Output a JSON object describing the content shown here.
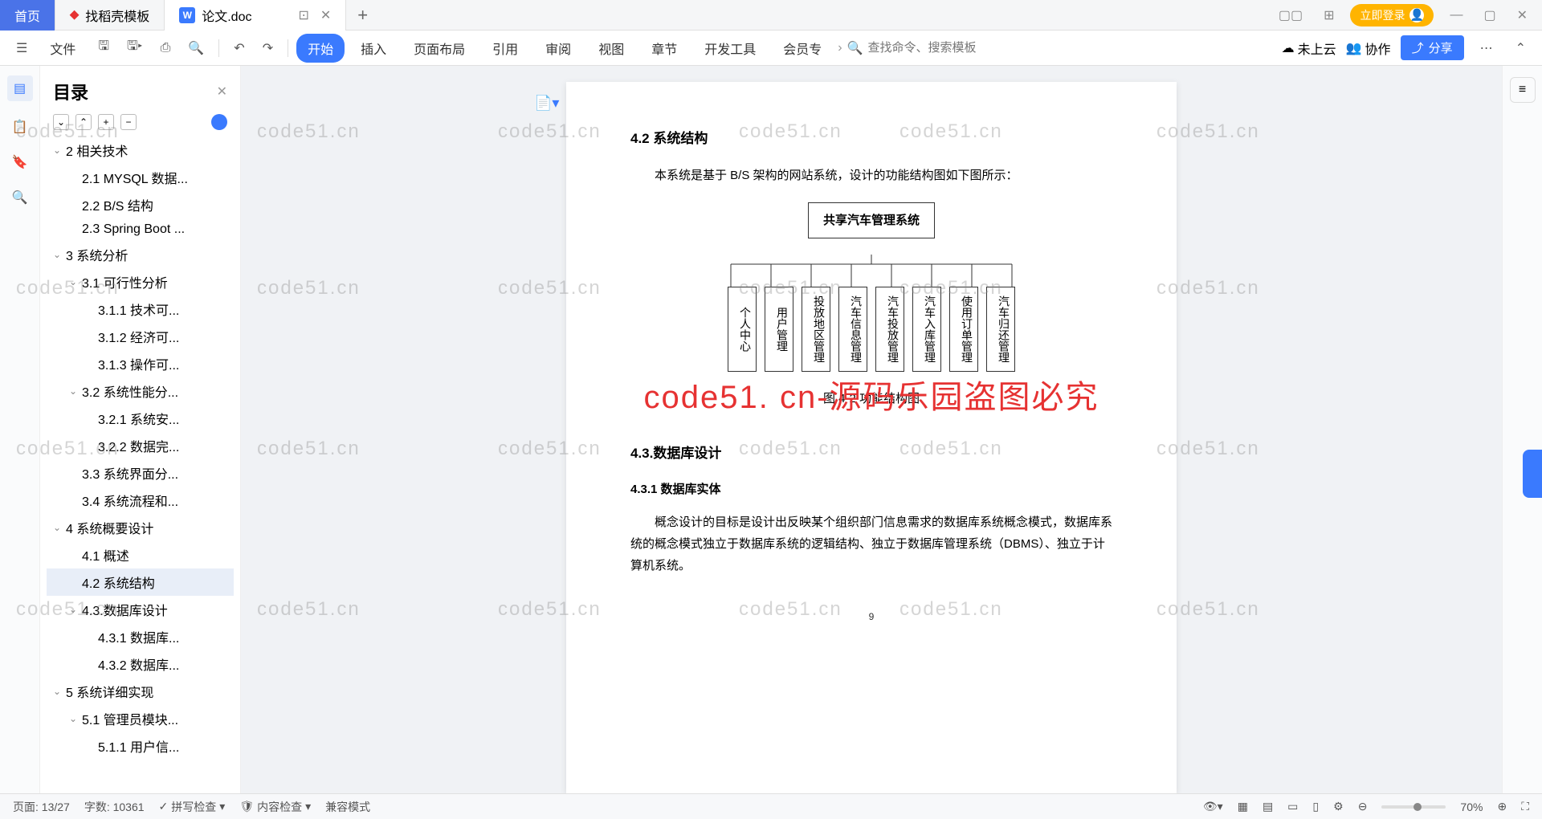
{
  "tabs": {
    "home": "首页",
    "template": "找稻壳模板",
    "doc": "论文.doc"
  },
  "titlebar": {
    "login": "立即登录"
  },
  "toolbar": {
    "file": "文件",
    "menu": [
      "开始",
      "插入",
      "页面布局",
      "引用",
      "审阅",
      "视图",
      "章节",
      "开发工具",
      "会员专"
    ],
    "search_ph": "查找命令、搜索模板",
    "not_uploaded": "未上云",
    "collab": "协作",
    "share": "分享"
  },
  "sidebar": {
    "title": "目录",
    "items": [
      {
        "t": "2 相关技术",
        "l": 0,
        "c": true
      },
      {
        "t": "2.1 MYSQL 数据...",
        "l": 1
      },
      {
        "t": "2.2 B/S 结构",
        "l": 1
      },
      {
        "t": "2.3 Spring Boot ...",
        "l": 1
      },
      {
        "t": "3 系统分析",
        "l": 0,
        "c": true
      },
      {
        "t": "3.1 可行性分析",
        "l": 1,
        "c": true
      },
      {
        "t": "3.1.1 技术可...",
        "l": 2
      },
      {
        "t": "3.1.2 经济可...",
        "l": 2
      },
      {
        "t": "3.1.3 操作可...",
        "l": 2
      },
      {
        "t": "3.2 系统性能分...",
        "l": 1,
        "c": true
      },
      {
        "t": "3.2.1 系统安...",
        "l": 2
      },
      {
        "t": "3.2.2 数据完...",
        "l": 2
      },
      {
        "t": "3.3 系统界面分...",
        "l": 1
      },
      {
        "t": "3.4 系统流程和...",
        "l": 1
      },
      {
        "t": "4 系统概要设计",
        "l": 0,
        "c": true
      },
      {
        "t": "4.1 概述",
        "l": 1
      },
      {
        "t": "4.2 系统结构",
        "l": 1,
        "sel": true
      },
      {
        "t": "4.3.数据库设计",
        "l": 1,
        "c": true
      },
      {
        "t": "4.3.1 数据库...",
        "l": 2
      },
      {
        "t": "4.3.2 数据库...",
        "l": 2
      },
      {
        "t": "5 系统详细实现",
        "l": 0,
        "c": true
      },
      {
        "t": "5.1 管理员模块...",
        "l": 1,
        "c": true
      },
      {
        "t": "5.1.1 用户信...",
        "l": 2
      }
    ]
  },
  "doc": {
    "h_4_2": "4.2 系统结构",
    "p1": "本系统是基于 B/S 架构的网站系统，设计的功能结构图如下图所示：",
    "org_root": "共享汽车管理系统",
    "org_leaves": [
      "个人中心",
      "用户管理",
      "投放地区管理",
      "汽车信息管理",
      "汽车投放管理",
      "汽车入库管理",
      "使用订单管理",
      "汽车归还管理"
    ],
    "caption1": "图 4-2 功能结构图",
    "h_4_3": "4.3.数据库设计",
    "h_4_3_1": "4.3.1 数据库实体",
    "p2": "概念设计的目标是设计出反映某个组织部门信息需求的数据库系统概念模式，数据库系统的概念模式独立于数据库系统的逻辑结构、独立于数据库管理系统（DBMS）、独立于计算机系统。",
    "page_num": "9"
  },
  "watermark": {
    "red": "code51. cn-源码乐园盗图必究",
    "bg": "code51.cn"
  },
  "status": {
    "page": "页面: 13/27",
    "words": "字数: 10361",
    "spell": "拼写检查",
    "content": "内容检查",
    "compat": "兼容模式",
    "zoom": "70%"
  },
  "chart_data": {
    "type": "tree",
    "title": "共享汽车管理系统",
    "children": [
      "个人中心",
      "用户管理",
      "投放地区管理",
      "汽车信息管理",
      "汽车投放管理",
      "汽车入库管理",
      "使用订单管理",
      "汽车归还管理"
    ],
    "caption": "图 4-2 功能结构图"
  }
}
